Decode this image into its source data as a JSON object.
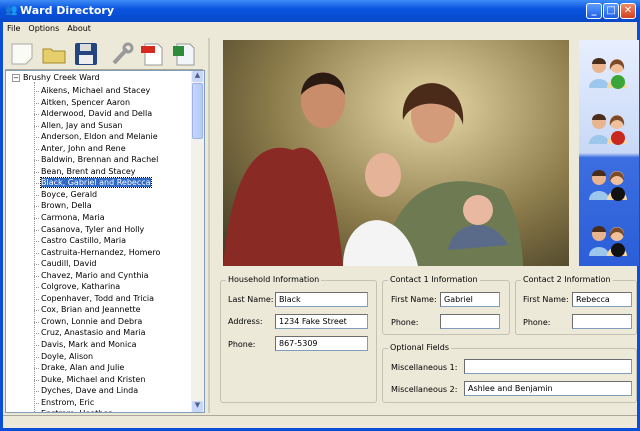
{
  "window": {
    "title": "Ward Directory"
  },
  "menu": [
    "File",
    "Options",
    "About"
  ],
  "toolbar": [
    "new-icon",
    "open-folder-icon",
    "save-icon",
    "settings-wrench-icon",
    "pdf-export-icon",
    "excel-export-icon"
  ],
  "tree": {
    "root": "Brushy Creek Ward",
    "selected_index": 8,
    "items": [
      "Aikens, Michael and Stacey",
      "Aitken, Spencer Aaron",
      "Alderwood, David and Della",
      "Allen, Jay and Susan",
      "Anderson, Eldon and Melanie",
      "Anter, John and Rene",
      "Baldwin, Brennan and Rachel",
      "Bean, Brent and Stacey",
      "Black, Gabriel and Rebecca",
      "Boyce, Gerald",
      "Brown, Della",
      "Carmona, Maria",
      "Casanova, Tyler and Holly",
      "Castro Castillo, Maria",
      "Castruita-Hernandez, Homero",
      "Caudill, David",
      "Chavez, Mario and Cynthia",
      "Colgrove, Katharina",
      "Copenhaver, Todd and Tricia",
      "Cox, Brian and Jeannette",
      "Crown, Lonnie and Debra",
      "Cruz, Anastasio and Maria",
      "Davis, Mark and Monica",
      "Doyle, Alison",
      "Drake, Alan and Julie",
      "Duke, Michael and Kristen",
      "Dyches, Dave and Linda",
      "Enstrom, Eric",
      "Enstrom, Heather"
    ]
  },
  "side_buttons": [
    "add-family-icon",
    "remove-family-icon",
    "camera-family-icon",
    "camera-remove-family-icon"
  ],
  "household": {
    "legend": "Household Information",
    "last_name_label": "Last Name:",
    "last_name": "Black",
    "address_label": "Address:",
    "address": "1234 Fake Street",
    "phone_label": "Phone:",
    "phone": "867-5309"
  },
  "contact1": {
    "legend": "Contact 1 Information",
    "first_name_label": "First Name:",
    "first_name": "Gabriel",
    "phone_label": "Phone:",
    "phone": ""
  },
  "contact2": {
    "legend": "Contact 2 Information",
    "first_name_label": "First Name:",
    "first_name": "Rebecca",
    "phone_label": "Phone:",
    "phone": ""
  },
  "optional": {
    "legend": "Optional Fields",
    "misc1_label": "Miscellaneous 1:",
    "misc1": "",
    "misc2_label": "Miscellaneous 2:",
    "misc2": "Ashlee and Benjamin"
  }
}
